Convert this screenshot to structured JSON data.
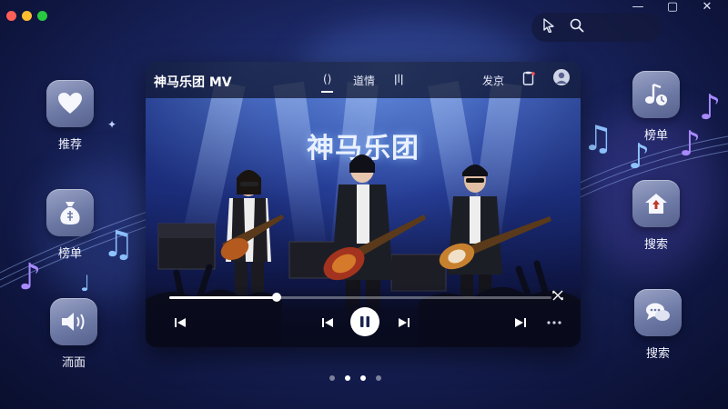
{
  "window": {
    "traffic_colors": [
      "#ff5f57",
      "#febc2e",
      "#28c840"
    ],
    "controls": [
      "—",
      "▢",
      "✕"
    ]
  },
  "search_bar": {
    "icons": [
      "cursor-icon",
      "search-icon"
    ]
  },
  "left_nav": [
    {
      "label": "推荐",
      "icon": "heart-icon"
    },
    {
      "label": "榜单",
      "icon": "money-bag-icon"
    },
    {
      "label": "洏面",
      "icon": "speaker-icon"
    }
  ],
  "right_nav": [
    {
      "label": "榜单",
      "icon": "music-note-icon"
    },
    {
      "label": "搜索",
      "icon": "home-icon"
    },
    {
      "label": "搜索",
      "icon": "chat-bubbles-icon"
    }
  ],
  "player": {
    "title": "神马乐团 MV",
    "tabs": [
      {
        "label": "()",
        "active": true
      },
      {
        "label": "道情",
        "active": false
      },
      {
        "label": "ǀlǀ",
        "active": false
      }
    ],
    "publish_label": "发京",
    "video_title": "神马乐团",
    "progress": 0.28,
    "colors": {
      "accent": "#ffffff",
      "stage_blue": "#1a2c7a"
    }
  },
  "pagination": {
    "count": 4,
    "active": [
      1,
      2
    ]
  }
}
